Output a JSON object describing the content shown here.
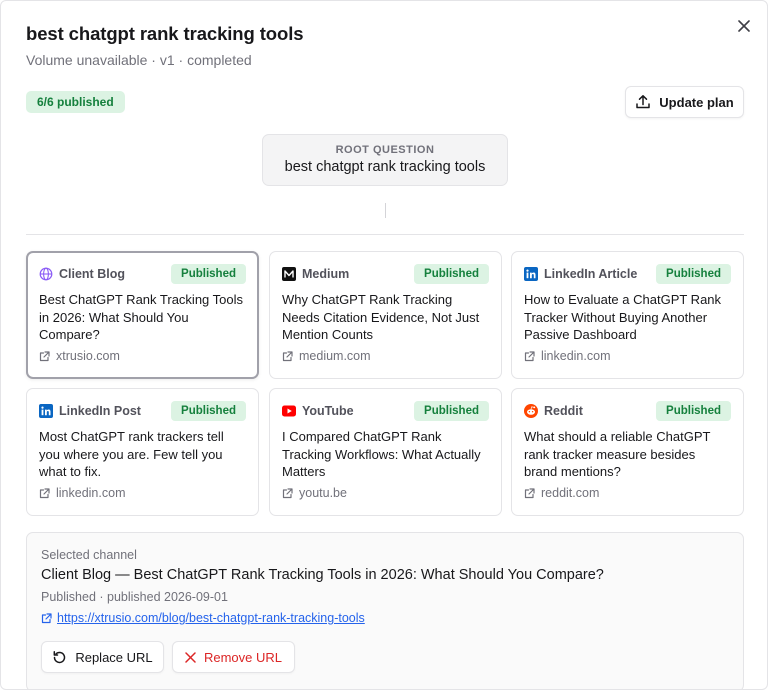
{
  "header": {
    "title": "best chatgpt rank tracking tools",
    "subtitle": "Volume unavailable · v1 · completed",
    "published_count": "6/6 published",
    "update_label": "Update plan"
  },
  "root": {
    "label": "ROOT QUESTION",
    "question": "best chatgpt rank tracking tools"
  },
  "channels": [
    {
      "name": "Client Blog",
      "icon": "globe-icon",
      "status": "Published",
      "title": "Best ChatGPT Rank Tracking Tools in 2026: What Should You Compare?",
      "domain": "xtrusio.com"
    },
    {
      "name": "Medium",
      "icon": "medium-icon",
      "status": "Published",
      "title": "Why ChatGPT Rank Tracking Needs Citation Evidence, Not Just Mention Counts",
      "domain": "medium.com"
    },
    {
      "name": "LinkedIn Article",
      "icon": "linkedin-icon",
      "status": "Published",
      "title": "How to Evaluate a ChatGPT Rank Tracker Without Buying Another Passive Dashboard",
      "domain": "linkedin.com"
    },
    {
      "name": "LinkedIn Post",
      "icon": "linkedin-icon",
      "status": "Published",
      "title": "Most ChatGPT rank trackers tell you where you are. Few tell you what to fix.",
      "domain": "linkedin.com"
    },
    {
      "name": "YouTube",
      "icon": "youtube-icon",
      "status": "Published",
      "title": "I Compared ChatGPT Rank Tracking Workflows: What Actually Matters",
      "domain": "youtu.be"
    },
    {
      "name": "Reddit",
      "icon": "reddit-icon",
      "status": "Published",
      "title": "What should a reliable ChatGPT rank tracker measure besides brand mentions?",
      "domain": "reddit.com"
    }
  ],
  "selected": {
    "label": "Selected channel",
    "title": "Client Blog — Best ChatGPT Rank Tracking Tools in 2026: What Should You Compare?",
    "meta": "Published · published 2026-09-01",
    "url": "https://xtrusio.com/blog/best-chatgpt-rank-tracking-tools",
    "replace_label": "Replace URL",
    "remove_label": "Remove URL"
  },
  "colors": {
    "success_bg": "#dcf3e3",
    "success_text": "#15803d",
    "danger": "#dc2626",
    "link": "#2563eb",
    "youtube": "#ff0000",
    "linkedin": "#0a66c2",
    "reddit": "#ff4500",
    "globe": "#8b5cf6"
  }
}
